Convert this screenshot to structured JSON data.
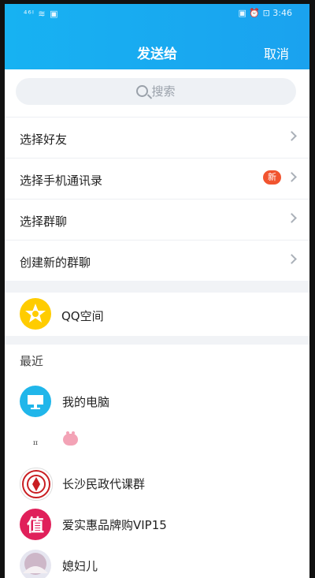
{
  "status_bar": {
    "left": "⁴⁶ᴵ ≋ ▣",
    "right": "▣ ⏰ ⊡ 3:46"
  },
  "header": {
    "title": "发送给",
    "cancel_label": "取消"
  },
  "search": {
    "placeholder": "搜索"
  },
  "menu": [
    {
      "label": "选择好友"
    },
    {
      "label": "选择手机通讯录",
      "badge": "新"
    },
    {
      "label": "选择群聊"
    },
    {
      "label": "创建新的群聊"
    }
  ],
  "qzone": {
    "label": "QQ空间"
  },
  "recent": {
    "title": "最近",
    "items": [
      {
        "label": "我的电脑"
      },
      {
        "label": ""
      },
      {
        "label": "长沙民政代课群"
      },
      {
        "label": "爱实惠品牌购VIP15",
        "avatar_text": "值"
      },
      {
        "label": "媳妇儿"
      }
    ]
  },
  "colors": {
    "header_blue": "#18aaf1",
    "badge_red": "#f1542f",
    "qzone_yellow": "#ffcc00",
    "computer_blue": "#20b6ea",
    "vip_pink": "#e0205a"
  }
}
